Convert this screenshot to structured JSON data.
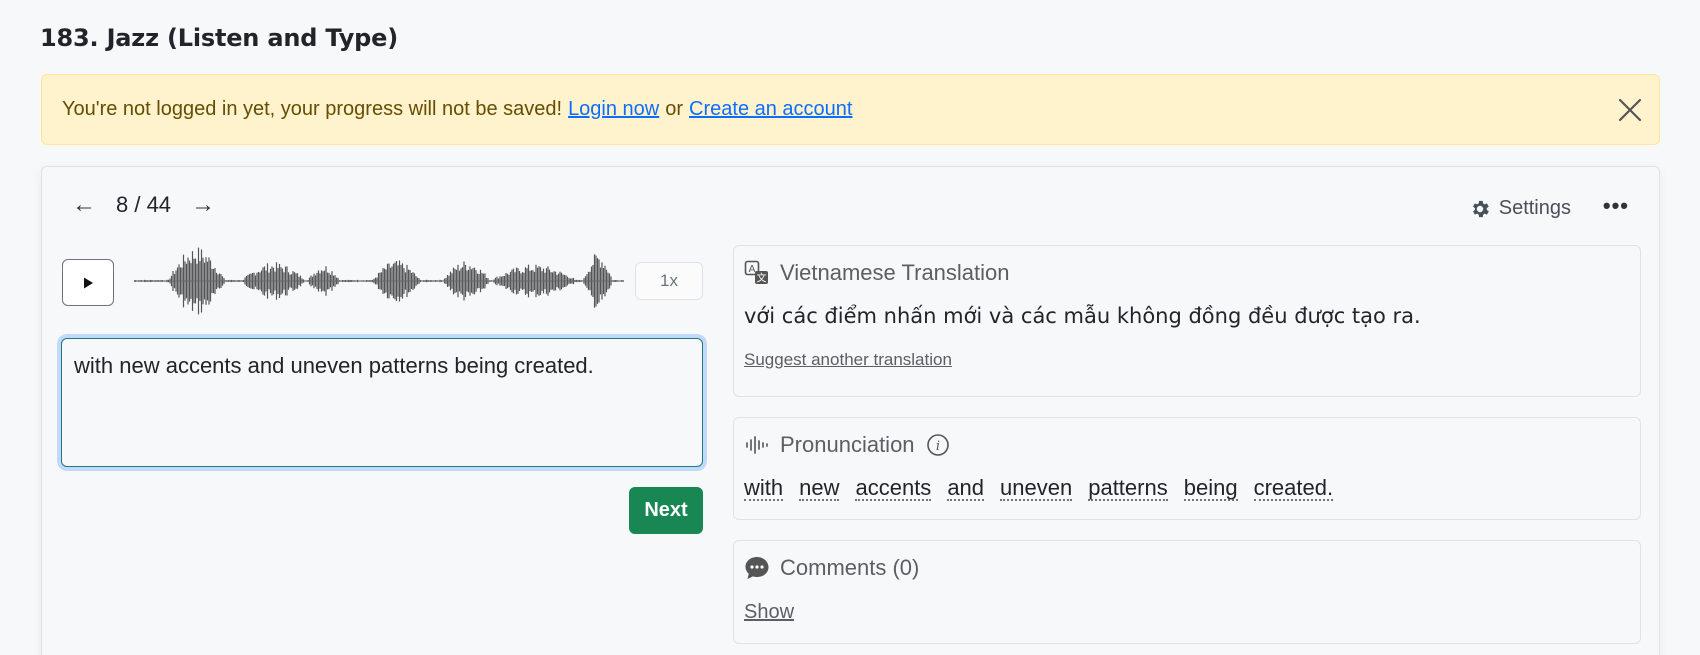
{
  "page": {
    "title": "183. Jazz (Listen and Type)"
  },
  "alert": {
    "message": "You're not logged in yet, your progress will not be saved!",
    "login_link": "Login now",
    "separator": "or",
    "create_link": "Create an account",
    "close_icon": "close-icon"
  },
  "nav": {
    "prev_icon": "arrow-left-icon",
    "counter": "8 / 44",
    "next_icon": "arrow-right-icon",
    "settings_label": "Settings",
    "settings_icon": "gear-icon",
    "more_icon": "more-horizontal-icon"
  },
  "player": {
    "play_icon": "play-icon",
    "speed": "1x"
  },
  "answer": {
    "value": "with new accents and uneven patterns being created."
  },
  "next_button": "Next",
  "translation": {
    "title": "Vietnamese Translation",
    "text": "với các điểm nhấn mới và các mẫu không đồng đều được tạo ra.",
    "suggest": "Suggest another translation"
  },
  "pronunciation": {
    "title": "Pronunciation",
    "words": [
      "with",
      "new",
      "accents",
      "and",
      "uneven",
      "patterns",
      "being",
      "created."
    ]
  },
  "comments": {
    "title": "Comments (0)",
    "show": "Show"
  },
  "colors": {
    "accent_green": "#198754",
    "alert_bg": "#fff3cd",
    "link_blue": "#0d6efd"
  }
}
